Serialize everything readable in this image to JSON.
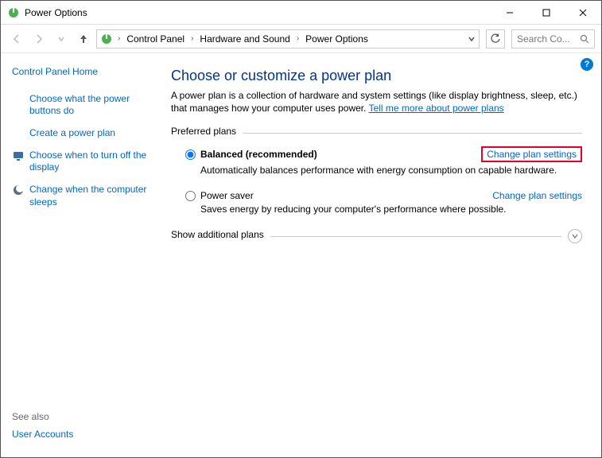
{
  "window": {
    "title": "Power Options"
  },
  "breadcrumb": {
    "seg1": "Control Panel",
    "seg2": "Hardware and Sound",
    "seg3": "Power Options"
  },
  "search": {
    "placeholder": "Search Co..."
  },
  "sidebar": {
    "home": "Control Panel Home",
    "links": [
      "Choose what the power buttons do",
      "Create a power plan",
      "Choose when to turn off the display",
      "Change when the computer sleeps"
    ],
    "see_also": "See also",
    "user_accounts": "User Accounts"
  },
  "main": {
    "heading": "Choose or customize a power plan",
    "desc": "A power plan is a collection of hardware and system settings (like display brightness, sleep, etc.) that manages how your computer uses power. ",
    "desc_link": "Tell me more about power plans",
    "preferred": "Preferred plans",
    "plans": [
      {
        "name": "Balanced (recommended)",
        "desc": "Automatically balances performance with energy consumption on capable hardware.",
        "link": "Change plan settings"
      },
      {
        "name": "Power saver",
        "desc": "Saves energy by reducing your computer's performance where possible.",
        "link": "Change plan settings"
      }
    ],
    "additional": "Show additional plans"
  }
}
